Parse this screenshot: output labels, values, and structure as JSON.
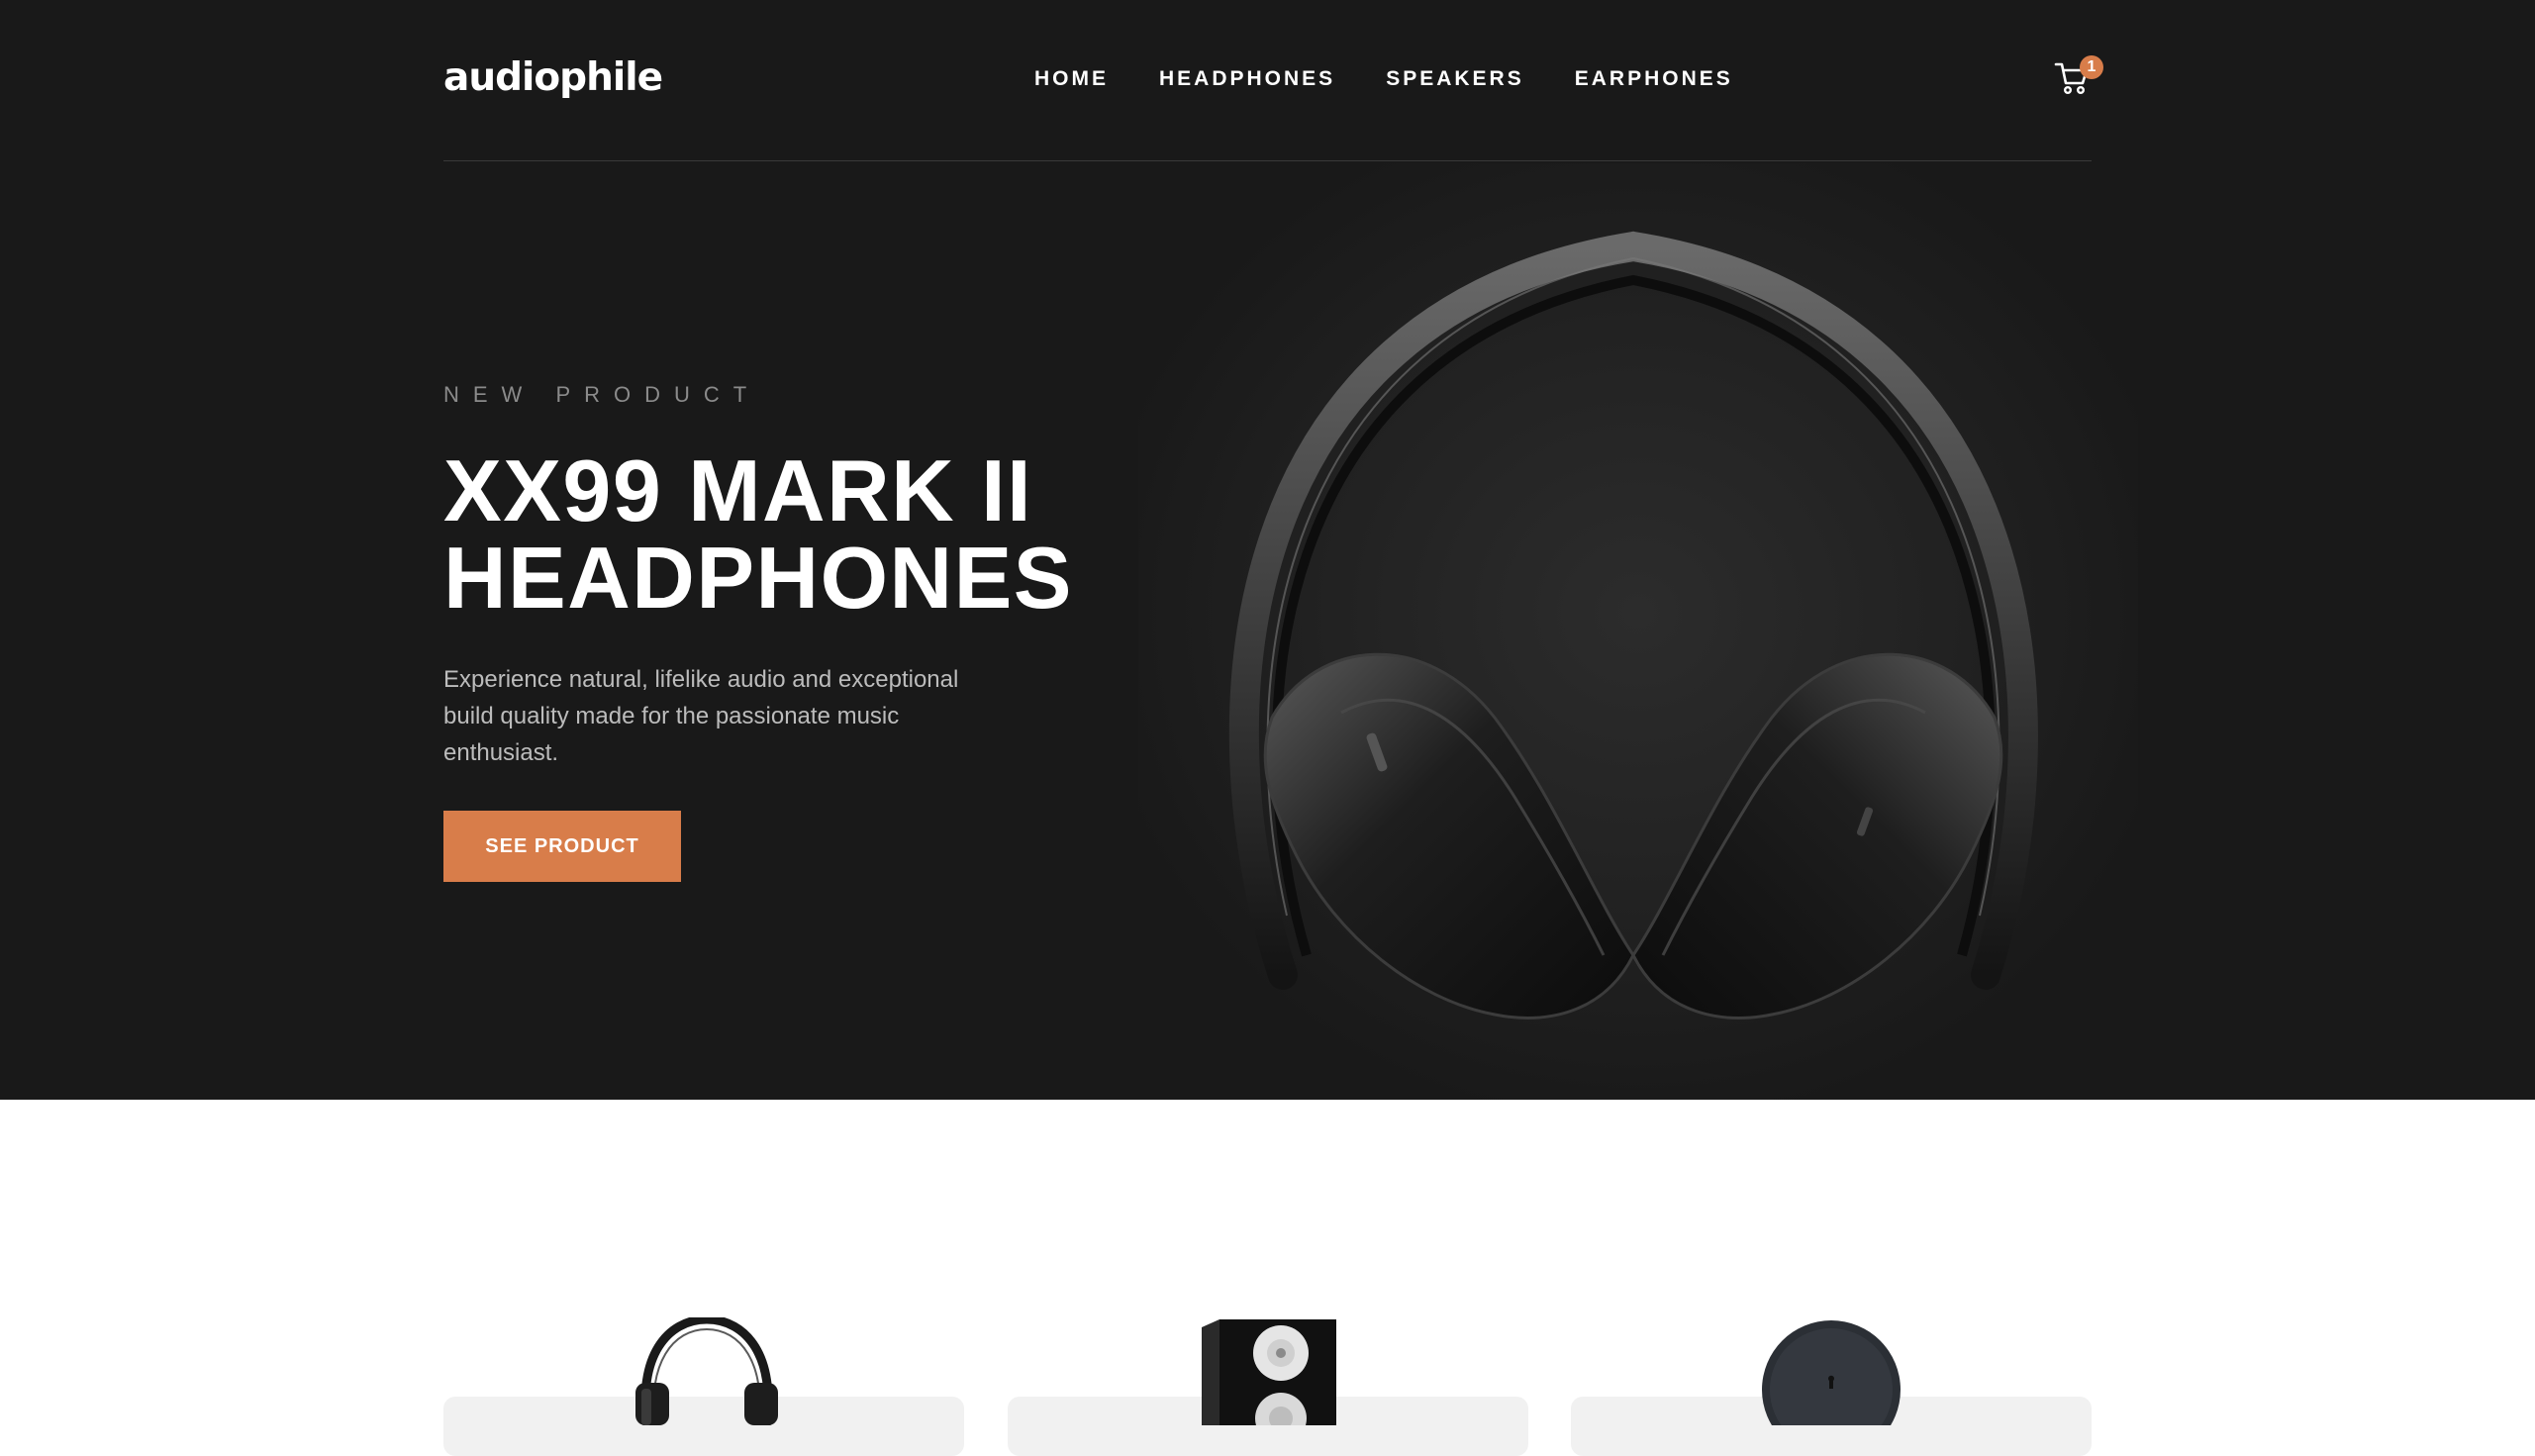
{
  "brand": {
    "logo_text": "audiophile"
  },
  "nav": {
    "items": [
      {
        "label": "HOME"
      },
      {
        "label": "HEADPHONES"
      },
      {
        "label": "SPEAKERS"
      },
      {
        "label": "EARPHONES"
      }
    ]
  },
  "cart": {
    "count": "1",
    "icon": "cart-icon"
  },
  "hero": {
    "overline": "NEW PRODUCT",
    "title_line1": "XX99 MARK II",
    "title_line2": "HEADPHONES",
    "description": "Experience natural, lifelike audio and exceptional build quality made for the passionate music enthusiast.",
    "cta_label": "SEE PRODUCT"
  },
  "categories": [
    {
      "icon": "headphones-thumbnail"
    },
    {
      "icon": "speaker-thumbnail"
    },
    {
      "icon": "earphones-case-thumbnail"
    }
  ],
  "colors": {
    "hero_bg": "#191919",
    "accent": "#d87d4a",
    "card_bg": "#f1f1f1"
  }
}
